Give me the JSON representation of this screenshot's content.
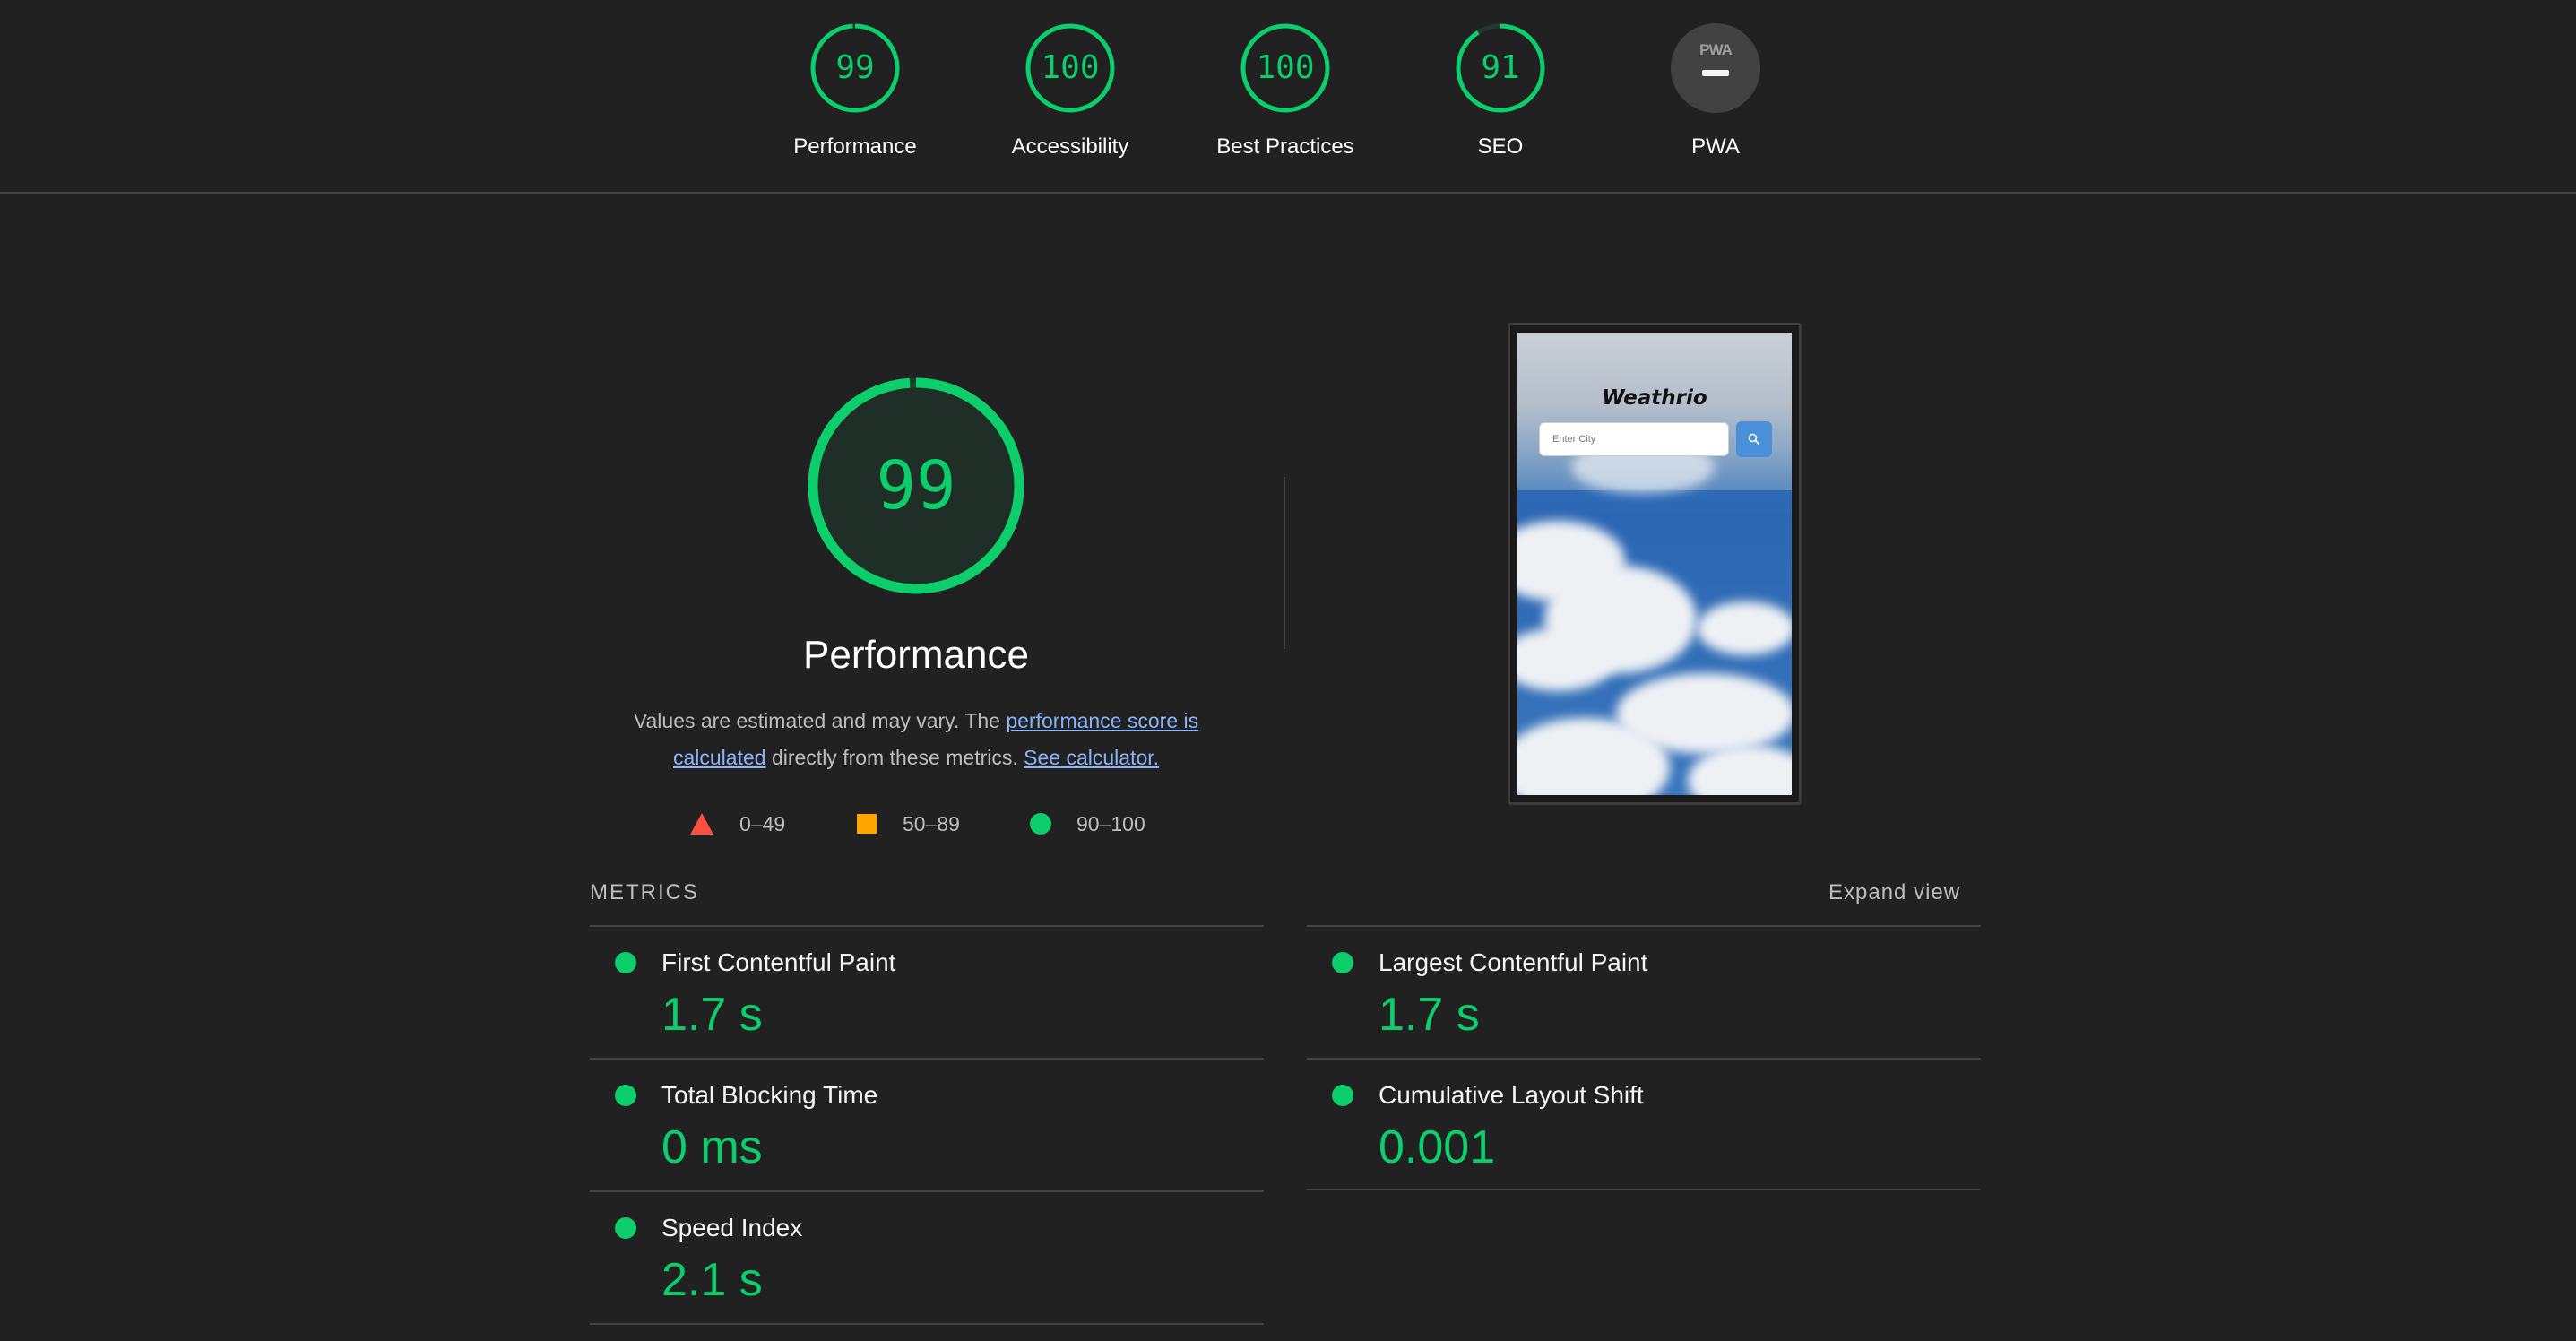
{
  "top_gauges": [
    {
      "label": "Performance",
      "score": "99"
    },
    {
      "label": "Accessibility",
      "score": "100"
    },
    {
      "label": "Best Practices",
      "score": "100"
    },
    {
      "label": "SEO",
      "score": "91"
    },
    {
      "label": "PWA",
      "badge_text": "PWA"
    }
  ],
  "main": {
    "score": "99",
    "title": "Performance",
    "desc_prefix": "Values are estimated and may vary. The ",
    "desc_link": "performance score is calculated",
    "desc_middle": " directly from these metrics. ",
    "desc_calc_link": "See calculator."
  },
  "legend": {
    "fail": "0–49",
    "average": "50–89",
    "pass": "90–100"
  },
  "preview": {
    "app_title": "Weathrio",
    "input_placeholder": "Enter City"
  },
  "metrics": {
    "header": "METRICS",
    "expand_label": "Expand view",
    "items": [
      {
        "title": "First Contentful Paint",
        "value": "1.7 s"
      },
      {
        "title": "Largest Contentful Paint",
        "value": "1.7 s"
      },
      {
        "title": "Total Blocking Time",
        "value": "0 ms"
      },
      {
        "title": "Cumulative Layout Shift",
        "value": "0.001"
      },
      {
        "title": "Speed Index",
        "value": "2.1 s"
      }
    ]
  },
  "colors": {
    "pass": "#0cce6b",
    "average": "#ffa400",
    "fail": "#ff4e42",
    "background": "#212121",
    "link": "#8ab4f8"
  }
}
